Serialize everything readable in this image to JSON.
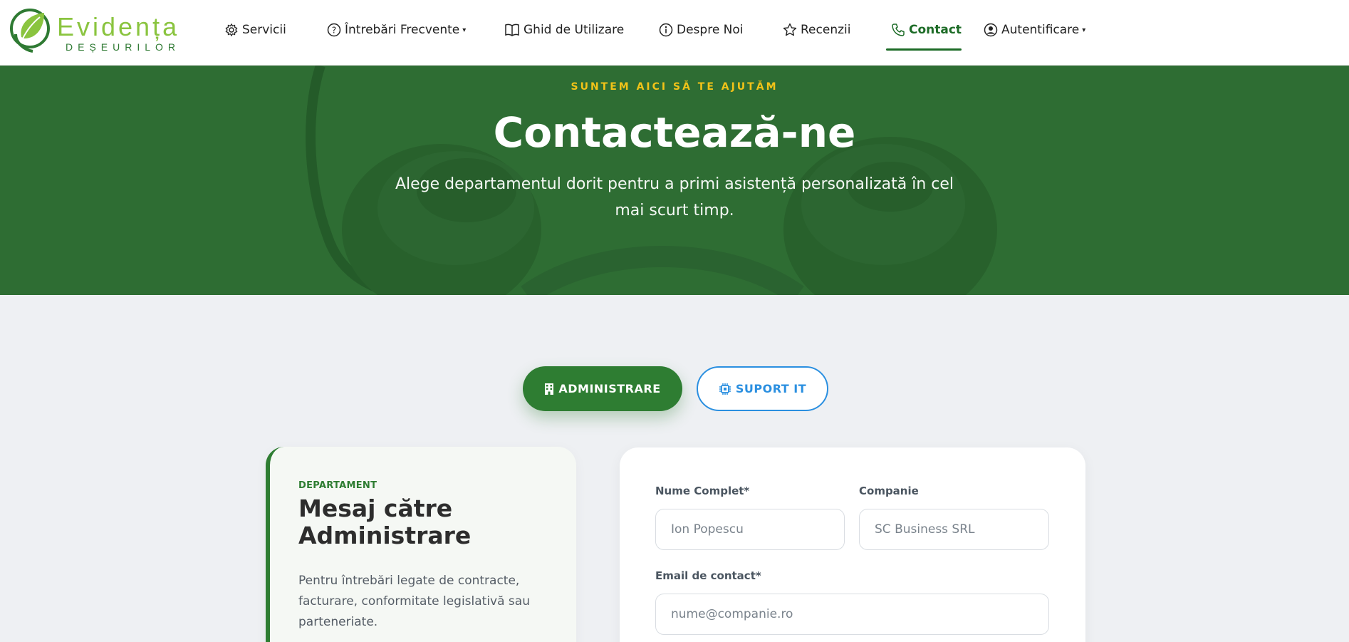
{
  "brand": {
    "name": "Evidența",
    "subtitle": "DEȘEURILOR"
  },
  "nav": {
    "items": [
      {
        "label": "Servicii",
        "icon": "gear-icon"
      },
      {
        "label": "Întrebări Frecvente",
        "icon": "question-circle-icon",
        "dropdown": true
      },
      {
        "label": "Ghid de Utilizare",
        "icon": "book-icon"
      },
      {
        "label": "Despre Noi",
        "icon": "info-circle-icon"
      },
      {
        "label": "Recenzii",
        "icon": "star-icon"
      },
      {
        "label": "Contact",
        "icon": "phone-icon",
        "active": true
      },
      {
        "label": "Autentificare",
        "icon": "user-circle-icon",
        "dropdown": true
      }
    ]
  },
  "hero": {
    "kicker": "SUNTEM AICI SĂ TE AJUTĂM",
    "title": "Contactează-ne",
    "subtitle": "Alege departamentul dorit pentru a primi asistență personalizată în cel mai scurt timp."
  },
  "departments": {
    "admin_label": "ADMINISTRARE",
    "it_label": "SUPORT IT",
    "selected": "ADMINISTRARE"
  },
  "info_card": {
    "label": "DEPARTAMENT",
    "title": "Mesaj către Administrare",
    "text": "Pentru întrebări legate de contracte, facturare, conformitate legislativă sau parteneriate."
  },
  "form": {
    "name_label": "Nume Complet*",
    "name_placeholder": "Ion Popescu",
    "company_label": "Companie",
    "company_placeholder": "SC Business SRL",
    "email_label": "Email de contact*",
    "email_placeholder": "nume@companie.ro"
  },
  "colors": {
    "primary_green": "#2e7d32",
    "hero_green": "#2e6d33",
    "accent_yellow": "#f2c318",
    "accent_blue": "#2a8fe0",
    "logo_green": "#8ac43f"
  }
}
